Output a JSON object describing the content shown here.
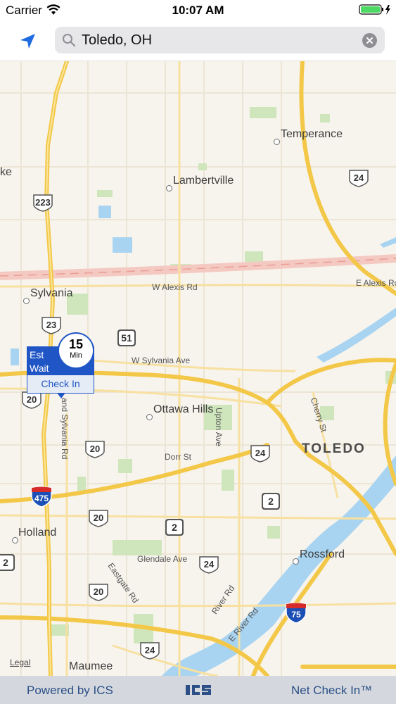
{
  "status_bar": {
    "carrier": "Carrier",
    "time": "10:07 AM"
  },
  "search": {
    "value": "Toledo, OH"
  },
  "map": {
    "places": {
      "temperance": "Temperance",
      "lambertville": "Lambertville",
      "sylvania": "Sylvania",
      "ottawa_hills": "Ottawa Hills",
      "toledo": "TOLEDO",
      "holland": "Holland",
      "rossford": "Rossford",
      "maumee": "Maumee",
      "ke": "ke"
    },
    "roads": {
      "w_alexis": "W Alexis Rd",
      "e_alexis": "E Alexis Ro",
      "w_sylvania": "W Sylvania Ave",
      "dorr": "Dorr St",
      "glendale": "Glendale Ave",
      "upton": "Upton Ave",
      "cherry": "Cherry St",
      "king_sylvania": "and Sylvania Rd",
      "eastgate": "Eastgate Rd",
      "river": "River Rd",
      "e_river": "E River Rd"
    },
    "shields": {
      "us223": "223",
      "us23": "23",
      "us24_top": "24",
      "us24_toledo": "24",
      "us24_glendale": "24",
      "us24_bottom": "24",
      "us20_left": "20",
      "us20_a": "20",
      "us20_b": "20",
      "us20_c": "20",
      "oh51": "51",
      "oh2_a": "2",
      "oh2_b": "2",
      "oh2_left": "2",
      "i475": "475",
      "i75": "75"
    },
    "legal": "Legal"
  },
  "callout": {
    "est": "Est",
    "wait": "Wait",
    "number": "15",
    "unit": "Min",
    "check_in": "Check In"
  },
  "footer": {
    "left": "Powered by ICS",
    "right": "Net Check In™"
  },
  "colors": {
    "accent": "#1f55c4",
    "road_major": "#f6cf5a",
    "water": "#a7d3f0",
    "park": "#c9e4b4"
  }
}
